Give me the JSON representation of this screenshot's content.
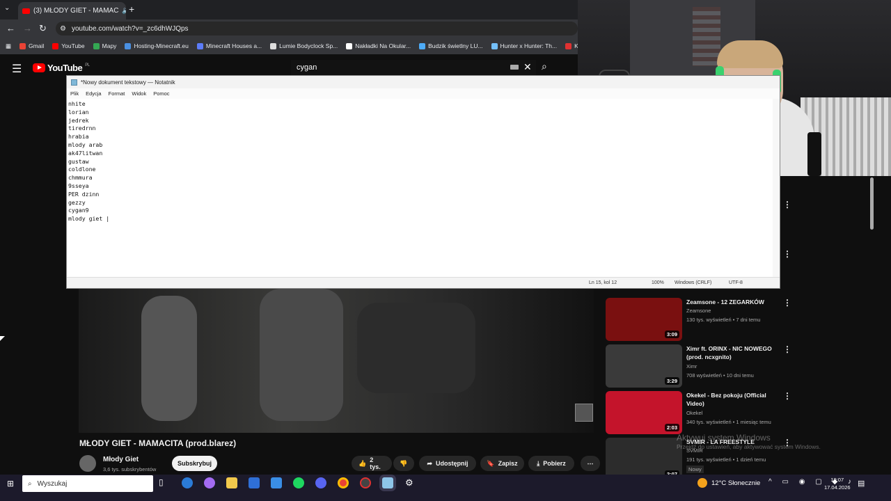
{
  "browser": {
    "tab_title": "(3) MŁODY GIET - MAMAC",
    "url": "youtube.com/watch?v=_zc6dhWJQps",
    "bookmarks": [
      {
        "label": "Gmail",
        "color": "#ea4335"
      },
      {
        "label": "YouTube",
        "color": "#ff0000"
      },
      {
        "label": "Mapy",
        "color": "#34a853"
      },
      {
        "label": "Hosting-Minecraft.eu",
        "color": "#4a90e2"
      },
      {
        "label": "Minecraft Houses a...",
        "color": "#5c7cfa"
      },
      {
        "label": "Lumie Bodyclock Sp...",
        "color": "#dddddd"
      },
      {
        "label": "Nakładki Na Okular...",
        "color": "#ffffff"
      },
      {
        "label": "Budzik świetlny LU...",
        "color": "#4dabf7"
      },
      {
        "label": "Hunter x Hunter: Th...",
        "color": "#74c0fc"
      },
      {
        "label": "Kick VOD",
        "color": "#e03131"
      }
    ]
  },
  "youtube": {
    "logo": "YouTube",
    "region": "PL",
    "search_query": "cygan"
  },
  "notepad": {
    "title": "*Nowy dokument tekstowy — Notatnik",
    "menu": [
      "Plik",
      "Edycja",
      "Format",
      "Widok",
      "Pomoc"
    ],
    "content": "nhite\nlorian\njedrek\ntiredrnn\nhrabia\nmlody arab\nak47litwan\ngustaw\ncoldlone\nchmmura\n9sseya\nPER dzinn\ngezzy\ncygan9\nmlody giet |",
    "status_position": "Ln 15, kol 12",
    "status_zoom": "100%",
    "status_eol": "Windows (CRLF)",
    "status_encoding": "UTF-8"
  },
  "video": {
    "title": "MŁODY GIET - MAMACITA (prod.blarez)",
    "channel": "Młody Giet",
    "subscribers": "3,6 tys. subskrybentów",
    "subscribe_label": "Subskrybuj",
    "likes": "2 tys.",
    "share_label": "Udostępnij",
    "save_label": "Zapisz",
    "download_label": "Pobierz"
  },
  "recommendations": [
    {
      "title": "Zeamsone - 12 ZEGARKÓW",
      "channel": "Zeamsone",
      "meta": "130 tys. wyświetleń • 7 dni temu",
      "duration": "3:09",
      "thumb_color": "#7a1010"
    },
    {
      "title": "Ximr ft. ORINX - NIC NOWEGO (prod. ncxgnito)",
      "channel": "Ximr",
      "meta": "708 wyświetleń • 10 dni temu",
      "duration": "3:29",
      "thumb_color": "#3a3a3a"
    },
    {
      "title": "Okekel - Bez pokoju (Official Video)",
      "channel": "Okekel",
      "meta": "340 tys. wyświetleń • 1 miesiąc temu",
      "duration": "2:03",
      "thumb_color": "#c4142b"
    },
    {
      "title": "SVMIR - LA FREESTYLE",
      "channel": "SVMIR",
      "meta": "191 tys. wyświetleń • 1 dzień temu",
      "duration": "2:07",
      "thumb_color": "#2c2c2c",
      "badge": "Nowy"
    }
  ],
  "watermark": {
    "line1": "Aktywuj system Windows",
    "line2": "Przejdź do ustawień, aby aktywować system Windows."
  },
  "taskbar": {
    "search_placeholder": "Wyszukaj",
    "weather": "12°C  Słonecznie",
    "time": "19:07",
    "date": "17.04.2026"
  }
}
